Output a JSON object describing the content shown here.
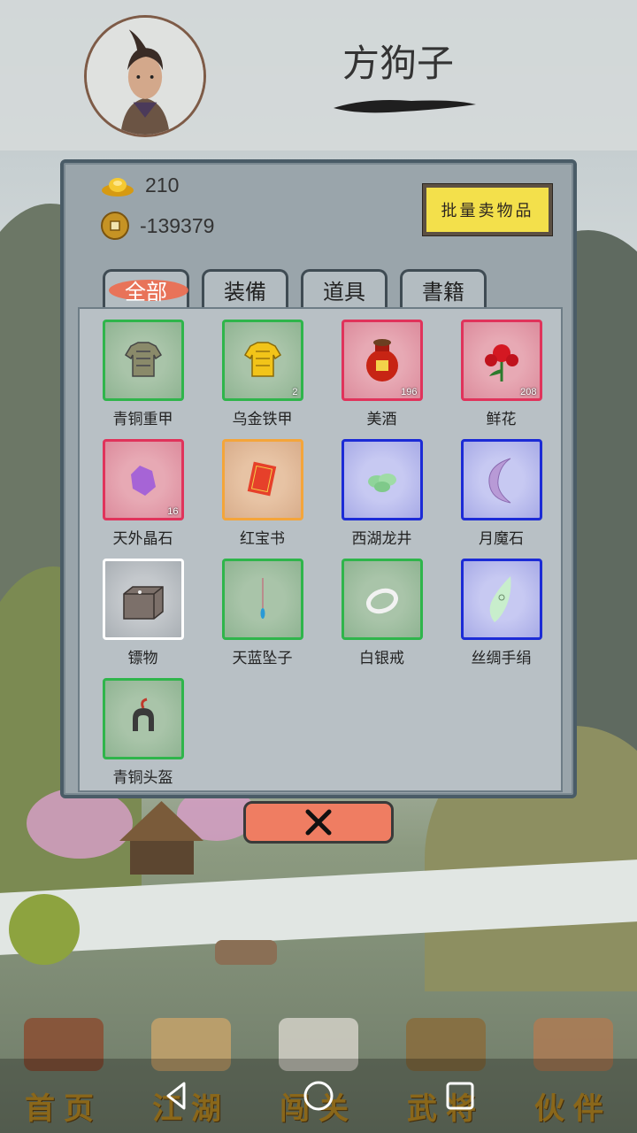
{
  "player": {
    "name": "方狗子"
  },
  "currency": {
    "gold": "210",
    "coins": "-139379"
  },
  "sell_button": "批量卖物品",
  "tabs": [
    {
      "label": "全部",
      "active": true
    },
    {
      "label": "装備",
      "active": false
    },
    {
      "label": "道具",
      "active": false
    },
    {
      "label": "書籍",
      "active": false
    }
  ],
  "items": [
    {
      "name": "青铜重甲",
      "count": "",
      "rarity": "green",
      "icon": "armor-icon"
    },
    {
      "name": "乌金铁甲",
      "count": "2",
      "rarity": "green",
      "icon": "golden-armor-icon"
    },
    {
      "name": "美酒",
      "count": "196",
      "rarity": "red",
      "icon": "wine-jar-icon"
    },
    {
      "name": "鲜花",
      "count": "208",
      "rarity": "red",
      "icon": "rose-icon"
    },
    {
      "name": "天外晶石",
      "count": "16",
      "rarity": "red",
      "icon": "crystal-icon"
    },
    {
      "name": "红宝书",
      "count": "",
      "rarity": "orange",
      "icon": "red-book-icon"
    },
    {
      "name": "西湖龙井",
      "count": "",
      "rarity": "blue",
      "icon": "tea-leaves-icon"
    },
    {
      "name": "月魔石",
      "count": "",
      "rarity": "blue",
      "icon": "moon-stone-icon"
    },
    {
      "name": "镖物",
      "count": "",
      "rarity": "white",
      "icon": "cargo-box-icon"
    },
    {
      "name": "天蓝坠子",
      "count": "",
      "rarity": "green",
      "icon": "pendant-icon"
    },
    {
      "name": "白银戒",
      "count": "",
      "rarity": "green",
      "icon": "silver-ring-icon"
    },
    {
      "name": "丝绸手绢",
      "count": "",
      "rarity": "blue",
      "icon": "silk-handkerchief-icon"
    },
    {
      "name": "青铜头盔",
      "count": "",
      "rarity": "green",
      "icon": "helmet-icon"
    }
  ],
  "nav": [
    {
      "label": "首页",
      "icon": "house-icon"
    },
    {
      "label": "江湖",
      "icon": "scroll-icon"
    },
    {
      "label": "闯关",
      "icon": "crossed-swords-icon"
    },
    {
      "label": "武将",
      "icon": "warrior-icon"
    },
    {
      "label": "伙伴",
      "icon": "partners-icon"
    }
  ],
  "colors": {
    "rarity_green": "#2fb54b",
    "rarity_red": "#e0335b",
    "rarity_orange": "#f4a53a",
    "rarity_blue": "#1c2bd6",
    "rarity_white": "#ffffff",
    "sell_button_bg": "#f3e04b",
    "close_button_bg": "#ef7d62",
    "nav_label": "#b98a23"
  }
}
